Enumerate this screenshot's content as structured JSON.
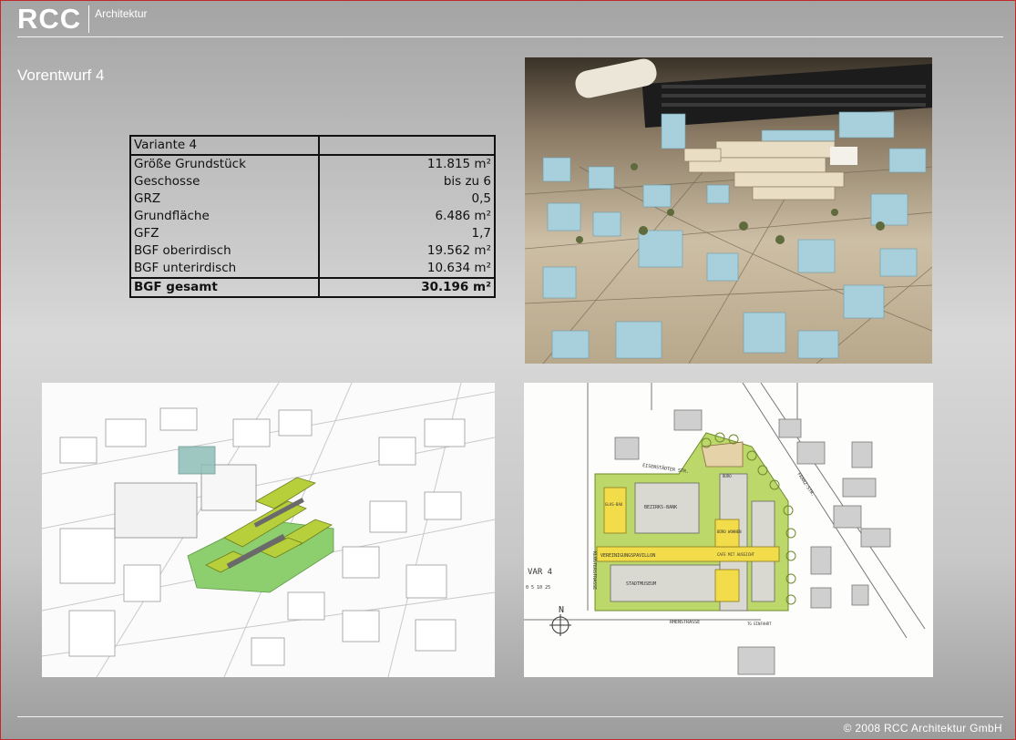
{
  "header": {
    "logo": "RCC",
    "logo_sub": "Architektur"
  },
  "page_title": "Vorentwurf 4",
  "table": {
    "header_label": "Variante 4",
    "rows": [
      {
        "label": "Größe Grundstück",
        "value": "11.815 m²"
      },
      {
        "label": "Geschosse",
        "value": "bis zu 6"
      },
      {
        "label": "GRZ",
        "value": "0,5"
      },
      {
        "label": "Grundfläche",
        "value": "6.486 m²"
      },
      {
        "label": "GFZ",
        "value": "1,7"
      },
      {
        "label": "BGF oberirdisch",
        "value": "19.562 m²"
      },
      {
        "label": "BGF unterirdisch",
        "value": "10.634 m²"
      }
    ],
    "total": {
      "label": "BGF gesamt",
      "value": "30.196 m²"
    }
  },
  "sketch": {
    "labels": {
      "var": "VAR 4",
      "north": "N",
      "street_top": "EISENSTÄDTER STR.",
      "street_right": "FRANZ-STR.",
      "street_left": "KLOSTERSTRASSE",
      "street_bottom": "RHENSTRASSE",
      "tg": "TG EINFAHRT",
      "bau": "GLAS-BAU",
      "bank": "BEZIRKS-BANK",
      "pavilion": "VEREINIGUNGSPAVILLON",
      "cafe": "CAFE MIT AUSSICHT",
      "mus": "STADTMUSEUM",
      "buro": "BÜRO",
      "wohnen": "BÜRO WOHNEN",
      "scale": "0 5 10 25"
    }
  },
  "footer": {
    "copyright": "© 2008 RCC Architektur GmbH"
  }
}
